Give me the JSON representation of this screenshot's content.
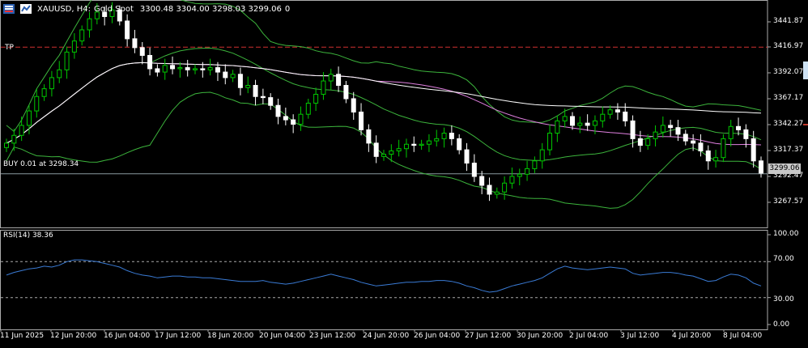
{
  "window": {
    "symbol": "XAUUSD, H4:",
    "instrument": "Gold Spot",
    "ohlc": "3300.48 3304.00 3298.03 3299.06",
    "volume": "0"
  },
  "tp_label": "TP",
  "position_label": "BUY 0.01 at 3298.34",
  "current_price": "3299.06",
  "price_axis": [
    "3441.87",
    "3416.97",
    "3392.07",
    "3367.17",
    "3342.27",
    "3317.37",
    "3292.47",
    "3267.57"
  ],
  "rsi": {
    "label": "RSI(14) 38.36",
    "axis": [
      "100.00",
      "70.00",
      "30.00",
      "0.00"
    ]
  },
  "time_axis": [
    "11 Jun 2025",
    "12 Jun 20:00",
    "16 Jun 04:00",
    "17 Jun 12:00",
    "18 Jun 20:00",
    "20 Jun 04:00",
    "23 Jun 12:00",
    "24 Jun 20:00",
    "26 Jun 04:00",
    "27 Jun 12:00",
    "30 Jun 20:00",
    "2 Jul 04:00",
    "3 Jul 12:00",
    "4 Jul 20:00",
    "8 Jul 04:00"
  ],
  "colors": {
    "bull": "#00c800",
    "bear": "#ffffff",
    "band": "#3cb43c",
    "ma": "#e080e0",
    "ma_long": "#ffffff",
    "rsi": "#3a7bd5",
    "tp": "#d03030"
  },
  "chart_data": {
    "type": "candlestick",
    "closes": [
      3326,
      3333,
      3342,
      3355,
      3368,
      3375,
      3385,
      3392,
      3408,
      3418,
      3428,
      3438,
      3444,
      3440,
      3446,
      3436,
      3420,
      3412,
      3405,
      3393,
      3390,
      3396,
      3393,
      3394,
      3392,
      3393,
      3392,
      3394,
      3390,
      3385,
      3388,
      3376,
      3378,
      3368,
      3367,
      3360,
      3350,
      3347,
      3343,
      3352,
      3362,
      3370,
      3382,
      3388,
      3378,
      3366,
      3354,
      3338,
      3326,
      3314,
      3316,
      3319,
      3321,
      3325,
      3324,
      3325,
      3328,
      3330,
      3335,
      3330,
      3320,
      3308,
      3296,
      3288,
      3280,
      3282,
      3290,
      3296,
      3298,
      3303,
      3310,
      3320,
      3335,
      3346,
      3350,
      3342,
      3344,
      3342,
      3346,
      3352,
      3356,
      3354,
      3346,
      3330,
      3324,
      3330,
      3336,
      3342,
      3340,
      3334,
      3328,
      3326,
      3319,
      3310,
      3313,
      3330,
      3341,
      3338,
      3330,
      3310,
      3299
    ],
    "price_range": [
      3253,
      3452
    ],
    "tp_level": 3412.5,
    "position_price": 3298.34,
    "rsi_values": [
      55,
      58,
      60,
      62,
      63,
      65,
      64,
      66,
      70,
      72,
      72,
      71,
      70,
      68,
      66,
      64,
      60,
      57,
      55,
      54,
      52,
      53,
      54,
      54,
      53,
      53,
      52,
      52,
      51,
      50,
      49,
      48,
      48,
      48,
      49,
      47,
      46,
      45,
      46,
      48,
      50,
      52,
      54,
      56,
      54,
      52,
      50,
      47,
      45,
      43,
      44,
      45,
      46,
      47,
      47,
      48,
      48,
      49,
      49,
      48,
      46,
      43,
      41,
      38,
      36,
      37,
      40,
      43,
      45,
      47,
      49,
      52,
      57,
      62,
      65,
      63,
      62,
      61,
      62,
      63,
      64,
      63,
      62,
      57,
      55,
      56,
      57,
      58,
      58,
      57,
      55,
      54,
      51,
      48,
      49,
      53,
      56,
      55,
      52,
      46,
      43
    ],
    "rsi_levels": [
      70,
      30
    ]
  }
}
